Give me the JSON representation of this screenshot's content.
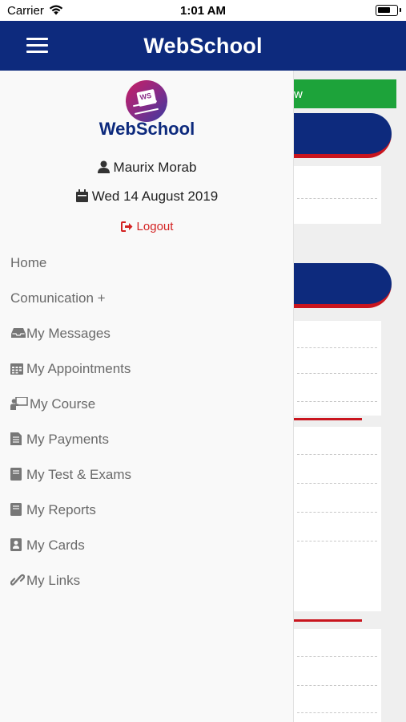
{
  "status_bar": {
    "carrier": "Carrier",
    "time": "1:01 AM"
  },
  "header": {
    "title": "WebSchool"
  },
  "drawer": {
    "brand": "WebSchool",
    "user_name": "Maurix Morab",
    "date": "Wed 14 August 2019",
    "logout_label": "Logout",
    "menu": [
      {
        "label": "Home",
        "icon": ""
      },
      {
        "label": "Comunication +",
        "icon": ""
      },
      {
        "label": "My Messages",
        "icon": "inbox-icon"
      },
      {
        "label": "My Appointments",
        "icon": "calendar-icon"
      },
      {
        "label": "My Course",
        "icon": "teacher-board-icon"
      },
      {
        "label": "My Payments",
        "icon": "receipt-icon"
      },
      {
        "label": "My Test & Exams",
        "icon": "book-icon"
      },
      {
        "label": "My Reports",
        "icon": "book-icon"
      },
      {
        "label": "My Cards",
        "icon": "id-card-icon"
      },
      {
        "label": "My Links",
        "icon": "link-icon"
      }
    ]
  },
  "background": {
    "green_button_label": "w"
  },
  "colors": {
    "primary": "#0d2a7d",
    "accent_red": "#c9151e",
    "green": "#1da33a",
    "logout_red": "#d32222"
  }
}
